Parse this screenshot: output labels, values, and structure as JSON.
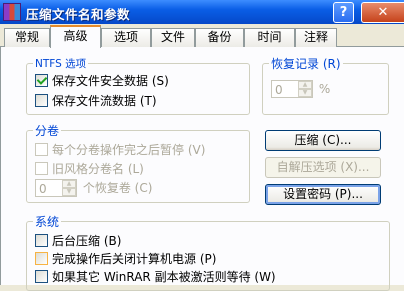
{
  "window": {
    "title": "压缩文件名和参数",
    "help_label": "?",
    "close_label": "✕"
  },
  "tabs": [
    {
      "label": "常规",
      "active": false
    },
    {
      "label": "高级",
      "active": true
    },
    {
      "label": "选项",
      "active": false
    },
    {
      "label": "文件",
      "active": false
    },
    {
      "label": "备份",
      "active": false
    },
    {
      "label": "时间",
      "active": false
    },
    {
      "label": "注释",
      "active": false
    }
  ],
  "ntfs": {
    "legend": "NTFS 选项",
    "save_security": {
      "label": "保存文件安全数据 (S)",
      "checked": true
    },
    "save_streams": {
      "label": "保存文件流数据 (T)",
      "checked": false
    }
  },
  "recovery": {
    "legend": "恢复记录 (R)",
    "value": "0",
    "unit": "%"
  },
  "volumes": {
    "legend": "分卷",
    "pause_each": {
      "label": "每个分卷操作完之后暂停 (V)",
      "checked": false,
      "disabled": true
    },
    "old_naming": {
      "label": "旧风格分卷名 (L)",
      "checked": false,
      "disabled": true
    },
    "recovery_volumes_value": "0",
    "recovery_volumes_label": "个恢复卷 (C)"
  },
  "buttons": {
    "compress": "压缩 (C)...",
    "sfx": "自解压选项 (X)...",
    "password": "设置密码 (P)..."
  },
  "system": {
    "legend": "系统",
    "background": {
      "label": "后台压缩 (B)",
      "checked": false
    },
    "shutdown": {
      "label": "完成操作后关闭计算机电源 (P)",
      "checked": false
    },
    "wait": {
      "label": "如果其它 WinRAR 副本被激活则等待 (W)",
      "checked": false
    }
  },
  "colors": {
    "titlebar": "#0a5ee6",
    "group_legend": "#0046d5",
    "tab_active_accent": "#e68b2c"
  }
}
